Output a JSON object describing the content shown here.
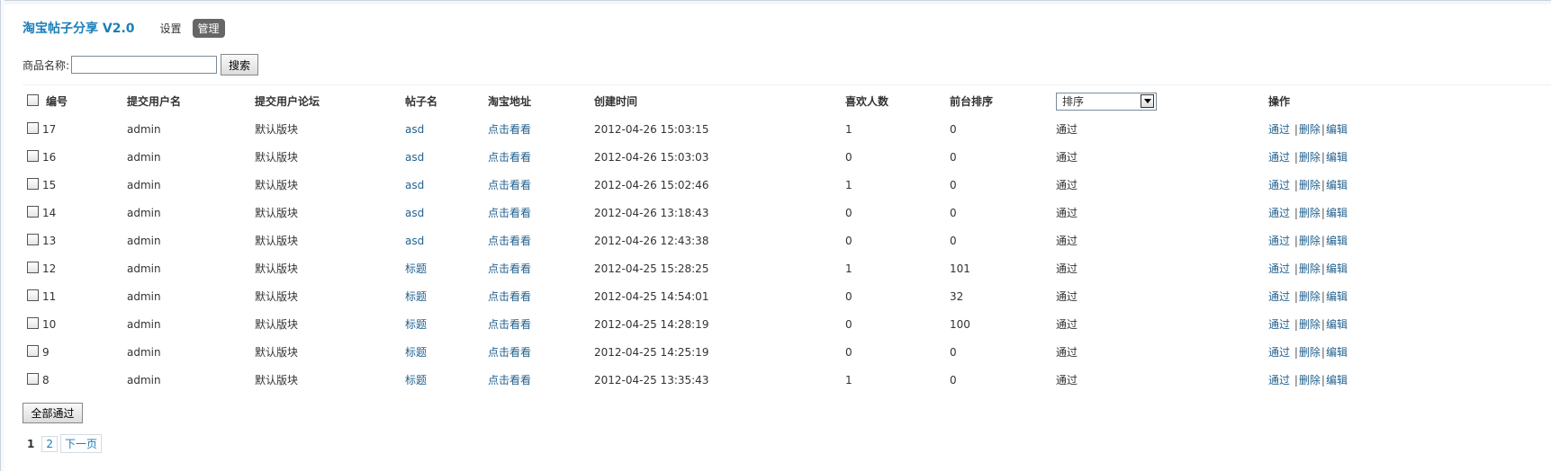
{
  "header": {
    "app_title": "淘宝帖子分享 V2.0",
    "nav_settings": "设置",
    "nav_manage": "管理"
  },
  "search": {
    "label": "商品名称:",
    "value": "",
    "button": "搜索"
  },
  "table": {
    "columns": {
      "id": "编号",
      "user": "提交用户名",
      "forum": "提交用户论坛",
      "post": "帖子名",
      "link": "淘宝地址",
      "created": "创建时间",
      "likes": "喜欢人数",
      "rank": "前台排序",
      "sort_select": "排序",
      "ops": "操作"
    },
    "ops": {
      "approve": "通过",
      "delete": "删除",
      "edit": "编辑"
    },
    "rows": [
      {
        "id": "17",
        "user": "admin",
        "forum": "默认版块",
        "post": "asd",
        "link": "点击看看",
        "created": "2012-04-26 15:03:15",
        "likes": "1",
        "rank": "0",
        "status": "通过"
      },
      {
        "id": "16",
        "user": "admin",
        "forum": "默认版块",
        "post": "asd",
        "link": "点击看看",
        "created": "2012-04-26 15:03:03",
        "likes": "0",
        "rank": "0",
        "status": "通过"
      },
      {
        "id": "15",
        "user": "admin",
        "forum": "默认版块",
        "post": "asd",
        "link": "点击看看",
        "created": "2012-04-26 15:02:46",
        "likes": "1",
        "rank": "0",
        "status": "通过"
      },
      {
        "id": "14",
        "user": "admin",
        "forum": "默认版块",
        "post": "asd",
        "link": "点击看看",
        "created": "2012-04-26 13:18:43",
        "likes": "0",
        "rank": "0",
        "status": "通过"
      },
      {
        "id": "13",
        "user": "admin",
        "forum": "默认版块",
        "post": "asd",
        "link": "点击看看",
        "created": "2012-04-26 12:43:38",
        "likes": "0",
        "rank": "0",
        "status": "通过"
      },
      {
        "id": "12",
        "user": "admin",
        "forum": "默认版块",
        "post": "标题",
        "link": "点击看看",
        "created": "2012-04-25 15:28:25",
        "likes": "1",
        "rank": "101",
        "status": "通过"
      },
      {
        "id": "11",
        "user": "admin",
        "forum": "默认版块",
        "post": "标题",
        "link": "点击看看",
        "created": "2012-04-25 14:54:01",
        "likes": "0",
        "rank": "32",
        "status": "通过"
      },
      {
        "id": "10",
        "user": "admin",
        "forum": "默认版块",
        "post": "标题",
        "link": "点击看看",
        "created": "2012-04-25 14:28:19",
        "likes": "0",
        "rank": "100",
        "status": "通过"
      },
      {
        "id": "9",
        "user": "admin",
        "forum": "默认版块",
        "post": "标题",
        "link": "点击看看",
        "created": "2012-04-25 14:25:19",
        "likes": "0",
        "rank": "0",
        "status": "通过"
      },
      {
        "id": "8",
        "user": "admin",
        "forum": "默认版块",
        "post": "标题",
        "link": "点击看看",
        "created": "2012-04-25 13:35:43",
        "likes": "1",
        "rank": "0",
        "status": "通过"
      }
    ]
  },
  "actions": {
    "approve_all": "全部通过"
  },
  "pager": {
    "current": "1",
    "page2": "2",
    "next": "下一页"
  },
  "colors": {
    "title": "#1a7fb8",
    "link": "#24628f",
    "active_nav_bg": "#666666"
  }
}
